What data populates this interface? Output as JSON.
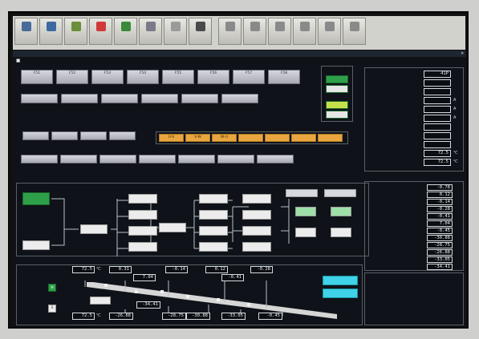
{
  "toolbar": {
    "buttons": [
      {
        "name": "operation-screen",
        "label": "",
        "icon": "tool-icon",
        "color": "#4a6a9a"
      },
      {
        "name": "graphic",
        "label": "",
        "icon": "people-icon",
        "color": "#3d6aa0"
      },
      {
        "name": "plan",
        "label": "",
        "icon": "folder-icon",
        "color": "#6b8e3a"
      },
      {
        "name": "alarm",
        "label": "",
        "icon": "alarm-icon",
        "color": "#d03a3a"
      },
      {
        "name": "guide",
        "label": "",
        "icon": "guide-icon",
        "color": "#3a8a3a"
      },
      {
        "name": "trend",
        "label": "",
        "icon": "trend-icon",
        "color": "#7a7a8a"
      },
      {
        "name": "monitor",
        "label": "",
        "icon": "monitor-icon",
        "color": "#9a9a9a"
      },
      {
        "name": "help",
        "label": "",
        "icon": "help-icon",
        "color": "#4a4a4a"
      },
      {
        "name": "back",
        "label": "",
        "icon": "back-icon",
        "color": "#8a8a8a"
      },
      {
        "name": "forward",
        "label": "",
        "icon": "forward-icon",
        "color": "#8a8a8a"
      },
      {
        "name": "print",
        "label": "",
        "icon": "print-icon",
        "color": "#8a8a8a"
      },
      {
        "name": "doc1",
        "label": "",
        "icon": "doc-icon",
        "color": "#8a8a8a"
      },
      {
        "name": "doc2",
        "label": "",
        "icon": "doc-icon",
        "color": "#8a8a8a"
      },
      {
        "name": "doc3",
        "label": "",
        "icon": "doc-icon",
        "color": "#8a8a8a"
      }
    ]
  },
  "status": {
    "title": "",
    "datetime": "",
    "arrow": "»"
  },
  "colors": {
    "accent": "#e9a640",
    "green": "#2fa04a",
    "cyan": "#3fd2e8",
    "screen": "#0f1319"
  },
  "breaker": {
    "title": "",
    "buttons": [
      {
        "code": "F51",
        "sub": ""
      },
      {
        "code": "F52",
        "sub": ""
      },
      {
        "code": "F53",
        "sub": ""
      },
      {
        "code": "F54",
        "sub": ""
      },
      {
        "code": "F55",
        "sub": ""
      },
      {
        "code": "F56",
        "sub": ""
      },
      {
        "code": "F57",
        "sub": ""
      },
      {
        "code": "F58",
        "sub": ""
      }
    ],
    "thermal_title": "",
    "thermal_buttons": [
      "",
      "",
      "",
      "",
      "",
      ""
    ]
  },
  "op_mode": {
    "title": "",
    "buttons": [
      "",
      "",
      "",
      ""
    ]
  },
  "power": {
    "title": "",
    "buttons": [
      "U-V",
      "V-W",
      "W-U",
      "",
      "",
      "",
      ""
    ]
  },
  "detect": {
    "title": "",
    "buttons": [
      "",
      "",
      "",
      ""
    ]
  },
  "push_limit": {
    "title": "",
    "buttons": [
      "",
      "",
      "",
      "",
      "",
      "",
      ""
    ]
  },
  "motion": {
    "title": "",
    "labels": [
      "",
      "",
      "",
      "",
      "",
      "",
      "",
      "",
      "",
      "",
      "",
      "",
      "",
      "",
      "",
      "",
      "",
      "",
      "",
      "",
      ""
    ]
  },
  "right": {
    "title": "",
    "rows": [
      {
        "label": "",
        "value": "41P",
        "unit": ""
      },
      {
        "label": "",
        "value": "",
        "unit": ""
      },
      {
        "label": "",
        "value": "",
        "unit": ""
      },
      {
        "label": "",
        "value": "",
        "unit": "A"
      },
      {
        "label": "",
        "value": "",
        "unit": "A"
      },
      {
        "label": "",
        "value": "",
        "unit": "A"
      },
      {
        "label": "",
        "value": "",
        "unit": ""
      },
      {
        "label": "",
        "value": "",
        "unit": ""
      },
      {
        "label": "",
        "value": "",
        "unit": ""
      },
      {
        "label": "",
        "value": "72.5",
        "unit": "℃"
      },
      {
        "label": "",
        "value": "72.5",
        "unit": "℃"
      }
    ],
    "stroke_title": "",
    "strokes": [
      {
        "label": "",
        "value": "-0.78",
        "unit": ""
      },
      {
        "label": "",
        "value": "0.12",
        "unit": ""
      },
      {
        "label": "",
        "value": "-0.14",
        "unit": ""
      },
      {
        "label": "",
        "value": "-0.28",
        "unit": ""
      },
      {
        "label": "",
        "value": "-0.41",
        "unit": ""
      },
      {
        "label": "",
        "value": "7.04",
        "unit": ""
      },
      {
        "label": "",
        "value": "-0.45",
        "unit": ""
      },
      {
        "label": "",
        "value": "-30.88",
        "unit": ""
      },
      {
        "label": "",
        "value": "-28.75",
        "unit": ""
      },
      {
        "label": "",
        "value": "-26.88",
        "unit": ""
      },
      {
        "label": "",
        "value": "-33.05",
        "unit": ""
      },
      {
        "label": "",
        "value": "-34.41",
        "unit": ""
      }
    ]
  },
  "girder": {
    "title": "",
    "temp_top": "72.5",
    "temp_bottom": "72.5",
    "unit_c": "℃",
    "top_vals": [
      "0.31",
      "-0.14",
      "0.12",
      "-0.28"
    ],
    "mid_vals": [
      "7.04",
      "-0.41"
    ],
    "bottom_vals": [
      "-26.88",
      "-28.75",
      "-30.88",
      "-33.05",
      "-0.45"
    ],
    "low_val": "-34.41",
    "left_label": "",
    "right_label": "",
    "cyan1": "",
    "cyan2": "",
    "n_label": "N",
    "s_label": "S"
  }
}
